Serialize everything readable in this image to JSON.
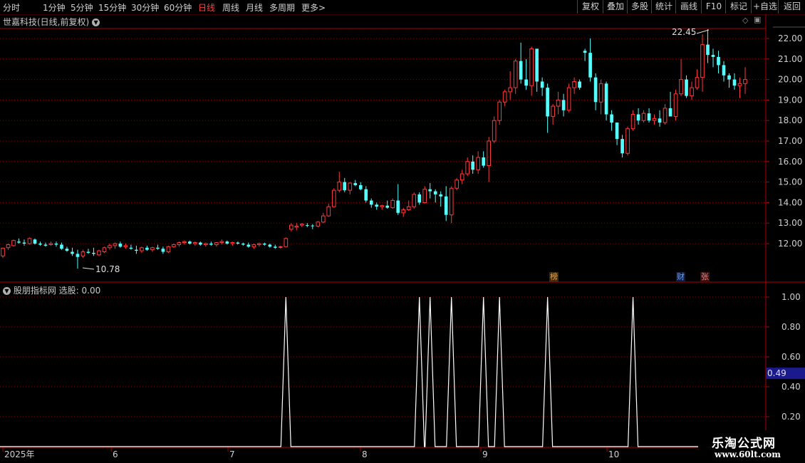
{
  "toolbar": {
    "periods": [
      "分时",
      "1分钟",
      "5分钟",
      "15分钟",
      "30分钟",
      "60分钟",
      "日线",
      "周线",
      "月线",
      "多周期",
      "更多"
    ],
    "active_period": "日线",
    "more_arrow": ">",
    "right_buttons": [
      "复权",
      "叠加",
      "多股",
      "统计",
      "画线",
      "F10",
      "标记",
      "+自选",
      "返回"
    ]
  },
  "stock": {
    "title": "世嘉科技(日线,前复权)",
    "high_label": "22.45",
    "low_label": "10.78",
    "price_axis": [
      "22.00",
      "21.00",
      "20.00",
      "19.00",
      "18.00",
      "17.00",
      "16.00",
      "15.00",
      "14.00",
      "13.00",
      "12.00"
    ],
    "events": [
      {
        "label": "榜",
        "color": "#e0a050",
        "bg": "#3a2a10"
      },
      {
        "label": "财",
        "color": "#6aa0ff",
        "bg": "#101c3a"
      },
      {
        "label": "张",
        "color": "#ff8080",
        "bg": "#3a1010"
      }
    ]
  },
  "indicator": {
    "name": "股朋指标网",
    "label": "选股:",
    "value": "0.00",
    "axis": [
      "1.00",
      "0.80",
      "0.60",
      "0.40",
      "0.20"
    ],
    "current_marker": "0.49",
    "signal_dates": [
      "2025-07-28",
      "2025-09-04",
      "2025-09-11",
      "2025-09-16",
      "2025-09-18",
      "2025-09-26",
      "2025-10-09",
      "2025-10-21"
    ]
  },
  "time_axis": [
    "2025年",
    "6",
    "7",
    "8",
    "9",
    "10"
  ],
  "watermark": {
    "line1": "乐淘公式网",
    "line2": "www.60lt.com"
  },
  "colors": {
    "up": "#ff3a3a",
    "down": "#54ffff",
    "grid": "#8a0000",
    "frame": "#b00000",
    "signal": "#ffffff",
    "marker_bg": "#1a1a8c"
  },
  "chart_data": {
    "type": "candlestick",
    "symbol": "世嘉科技",
    "period": "daily",
    "ylim": [
      11.0,
      22.8
    ],
    "candles_ohlc": [
      [
        11.4,
        11.8,
        11.3,
        11.78
      ],
      [
        11.8,
        12.0,
        11.7,
        11.95
      ],
      [
        11.9,
        12.2,
        11.85,
        12.15
      ],
      [
        12.1,
        12.25,
        12.0,
        12.05
      ],
      [
        12.05,
        12.2,
        11.9,
        12.0
      ],
      [
        12.0,
        12.3,
        11.95,
        12.25
      ],
      [
        12.2,
        12.25,
        11.95,
        12.0
      ],
      [
        12.0,
        12.1,
        11.9,
        11.95
      ],
      [
        11.95,
        12.05,
        11.85,
        11.9
      ],
      [
        11.95,
        12.1,
        11.9,
        12.0
      ],
      [
        12.0,
        12.1,
        11.85,
        11.95
      ],
      [
        11.95,
        12.05,
        11.7,
        11.75
      ],
      [
        11.75,
        11.85,
        11.6,
        11.65
      ],
      [
        11.6,
        11.8,
        11.4,
        11.5
      ],
      [
        11.5,
        11.7,
        10.78,
        11.35
      ],
      [
        11.4,
        11.7,
        11.3,
        11.6
      ],
      [
        11.6,
        11.75,
        11.5,
        11.55
      ],
      [
        11.55,
        11.8,
        11.4,
        11.5
      ],
      [
        11.45,
        11.7,
        11.4,
        11.65
      ],
      [
        11.6,
        11.85,
        11.55,
        11.8
      ],
      [
        11.8,
        12.0,
        11.7,
        11.9
      ],
      [
        11.9,
        12.05,
        11.75,
        12.0
      ],
      [
        12.0,
        12.1,
        11.8,
        11.85
      ],
      [
        11.85,
        12.0,
        11.75,
        11.9
      ],
      [
        11.8,
        11.95,
        11.7,
        11.75
      ],
      [
        11.7,
        11.9,
        11.5,
        11.65
      ],
      [
        11.65,
        11.85,
        11.55,
        11.8
      ],
      [
        11.8,
        11.9,
        11.65,
        11.7
      ],
      [
        11.7,
        11.85,
        11.6,
        11.8
      ],
      [
        11.8,
        11.95,
        11.7,
        11.75
      ],
      [
        11.75,
        11.85,
        11.5,
        11.6
      ],
      [
        11.6,
        11.9,
        11.55,
        11.85
      ],
      [
        11.85,
        12.0,
        11.8,
        11.95
      ],
      [
        11.95,
        12.1,
        11.85,
        12.05
      ],
      [
        12.05,
        12.15,
        11.95,
        12.1
      ],
      [
        12.1,
        12.15,
        11.95,
        12.0
      ],
      [
        12.0,
        12.1,
        11.9,
        12.05
      ],
      [
        12.05,
        12.1,
        11.9,
        11.95
      ],
      [
        11.95,
        12.05,
        11.85,
        12.0
      ],
      [
        12.0,
        12.1,
        11.9,
        11.95
      ],
      [
        11.95,
        12.05,
        11.85,
        12.05
      ],
      [
        12.05,
        12.2,
        11.95,
        12.1
      ],
      [
        12.1,
        12.15,
        11.95,
        12.0
      ],
      [
        12.0,
        12.1,
        11.9,
        12.05
      ],
      [
        12.05,
        12.1,
        11.95,
        12.0
      ],
      [
        12.0,
        12.05,
        11.9,
        11.95
      ],
      [
        11.95,
        12.05,
        11.8,
        11.85
      ],
      [
        11.85,
        12.0,
        11.75,
        11.95
      ],
      [
        11.95,
        12.05,
        11.85,
        12.0
      ],
      [
        12.0,
        12.05,
        11.9,
        11.95
      ],
      [
        11.95,
        12.0,
        11.8,
        11.85
      ],
      [
        11.85,
        11.95,
        11.75,
        11.8
      ],
      [
        11.85,
        11.9,
        11.75,
        11.85
      ],
      [
        11.85,
        12.3,
        11.85,
        12.25
      ],
      [
        12.7,
        13.0,
        12.6,
        12.9
      ],
      [
        12.8,
        13.0,
        12.65,
        12.85
      ],
      [
        12.9,
        13.0,
        12.8,
        12.95
      ],
      [
        12.9,
        13.0,
        12.8,
        12.88
      ],
      [
        12.88,
        12.95,
        12.7,
        12.85
      ],
      [
        12.85,
        13.1,
        12.8,
        13.05
      ],
      [
        13.05,
        13.5,
        13.0,
        13.35
      ],
      [
        13.35,
        13.95,
        13.3,
        13.8
      ],
      [
        13.8,
        14.7,
        13.75,
        14.6
      ],
      [
        14.6,
        15.5,
        14.5,
        15.0
      ],
      [
        15.0,
        15.2,
        14.5,
        14.6
      ],
      [
        14.6,
        15.0,
        14.4,
        14.95
      ],
      [
        14.95,
        15.1,
        14.8,
        14.85
      ],
      [
        14.85,
        15.0,
        14.6,
        14.65
      ],
      [
        14.65,
        14.8,
        14.0,
        14.1
      ],
      [
        14.1,
        14.2,
        13.75,
        13.9
      ],
      [
        13.9,
        14.0,
        13.65,
        13.8
      ],
      [
        13.8,
        13.9,
        13.65,
        13.85
      ],
      [
        13.85,
        14.1,
        13.7,
        13.75
      ],
      [
        13.75,
        14.2,
        13.7,
        14.1
      ],
      [
        14.1,
        14.9,
        13.4,
        13.5
      ],
      [
        13.5,
        13.75,
        13.3,
        13.65
      ],
      [
        13.65,
        14.1,
        13.6,
        13.8
      ],
      [
        13.8,
        14.5,
        13.7,
        14.4
      ],
      [
        14.4,
        14.5,
        13.9,
        14.0
      ],
      [
        14.0,
        14.8,
        13.95,
        14.65
      ],
      [
        14.65,
        14.95,
        14.2,
        14.55
      ],
      [
        14.55,
        14.65,
        14.0,
        14.4
      ],
      [
        14.4,
        14.55,
        13.8,
        14.3
      ],
      [
        14.3,
        14.8,
        13.1,
        13.4
      ],
      [
        13.4,
        14.8,
        13.0,
        14.7
      ],
      [
        14.7,
        15.2,
        14.6,
        15.1
      ],
      [
        15.1,
        15.6,
        14.9,
        15.4
      ],
      [
        15.4,
        16.2,
        15.3,
        16.0
      ],
      [
        16.0,
        16.3,
        15.4,
        15.6
      ],
      [
        15.6,
        16.5,
        15.4,
        16.2
      ],
      [
        16.2,
        16.5,
        15.7,
        15.8
      ],
      [
        15.8,
        17.2,
        15.0,
        17.0
      ],
      [
        17.0,
        18.2,
        16.9,
        18.0
      ],
      [
        18.0,
        19.0,
        17.8,
        18.9
      ],
      [
        18.9,
        19.5,
        18.7,
        19.4
      ],
      [
        19.4,
        20.4,
        19.0,
        19.6
      ],
      [
        19.6,
        21.0,
        19.3,
        20.9
      ],
      [
        20.9,
        21.8,
        19.8,
        20.0
      ],
      [
        20.0,
        21.0,
        19.5,
        19.7
      ],
      [
        19.7,
        21.6,
        19.2,
        21.5
      ],
      [
        21.5,
        20.8,
        19.4,
        19.9
      ],
      [
        19.9,
        20.1,
        19.2,
        19.6
      ],
      [
        19.6,
        19.8,
        17.4,
        18.2
      ],
      [
        18.2,
        18.8,
        17.8,
        18.7
      ],
      [
        18.7,
        19.4,
        18.3,
        19.0
      ],
      [
        19.0,
        19.3,
        18.2,
        18.5
      ],
      [
        18.5,
        19.8,
        18.4,
        19.6
      ],
      [
        19.6,
        20.1,
        19.3,
        19.9
      ],
      [
        19.9,
        20.0,
        19.5,
        19.6
      ],
      [
        21.4,
        21.5,
        20.9,
        21.3
      ],
      [
        21.3,
        22.0,
        19.9,
        20.1
      ],
      [
        20.1,
        20.3,
        18.5,
        18.9
      ],
      [
        18.9,
        20.0,
        18.3,
        19.8
      ],
      [
        19.8,
        19.9,
        18.0,
        18.3
      ],
      [
        18.3,
        18.5,
        17.5,
        17.9
      ],
      [
        17.9,
        17.9,
        16.8,
        17.1
      ],
      [
        17.1,
        17.3,
        16.2,
        16.4
      ],
      [
        16.4,
        17.7,
        16.3,
        17.6
      ],
      [
        17.6,
        18.5,
        17.5,
        18.3
      ],
      [
        18.3,
        18.6,
        17.8,
        18.0
      ],
      [
        18.0,
        18.5,
        17.9,
        18.35
      ],
      [
        18.35,
        18.6,
        17.9,
        18.0
      ],
      [
        18.0,
        18.3,
        17.8,
        18.1
      ],
      [
        18.1,
        18.5,
        17.7,
        17.9
      ],
      [
        17.9,
        18.8,
        17.8,
        18.6
      ],
      [
        18.6,
        19.4,
        18.3,
        18.2
      ],
      [
        18.2,
        19.5,
        18.0,
        19.3
      ],
      [
        19.3,
        21.0,
        19.2,
        20.0
      ],
      [
        20.0,
        20.2,
        19.1,
        19.2
      ],
      [
        19.2,
        19.9,
        19.0,
        19.6
      ],
      [
        19.6,
        20.5,
        19.5,
        20.1
      ],
      [
        20.1,
        22.2,
        19.4,
        21.7
      ],
      [
        21.7,
        22.45,
        20.8,
        21.2
      ],
      [
        21.2,
        21.5,
        20.6,
        21.1
      ],
      [
        21.1,
        21.4,
        20.3,
        20.7
      ],
      [
        20.7,
        20.9,
        19.9,
        20.2
      ],
      [
        20.2,
        20.3,
        19.6,
        20.0
      ],
      [
        20.0,
        20.3,
        19.5,
        19.7
      ],
      [
        19.7,
        20.1,
        19.1,
        19.8
      ],
      [
        19.8,
        20.6,
        19.3,
        20.0
      ]
    ]
  }
}
